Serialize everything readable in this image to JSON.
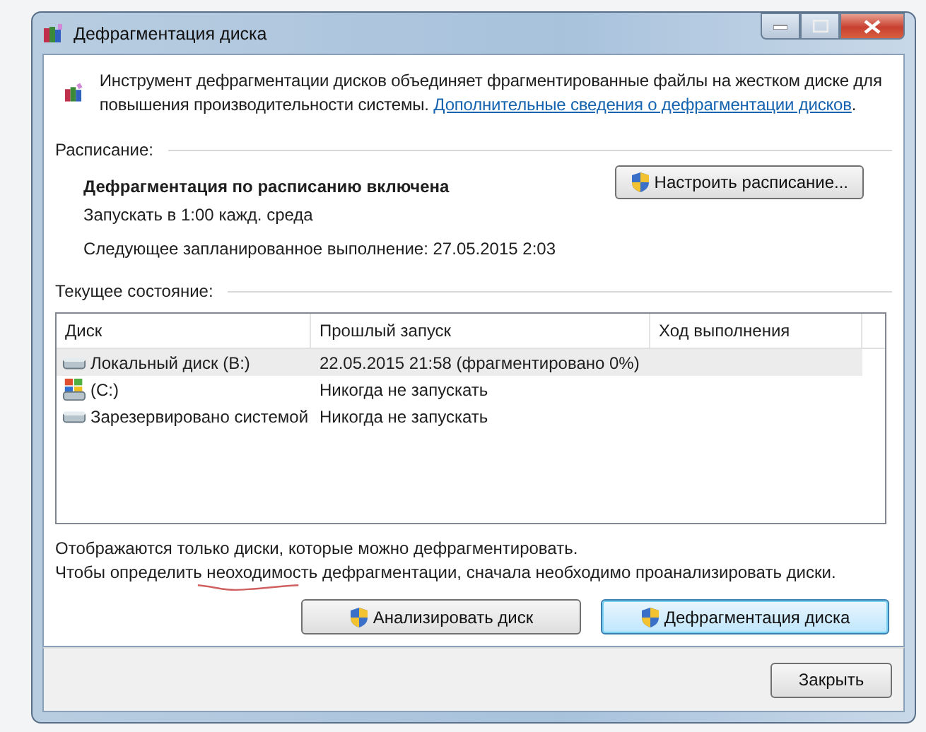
{
  "window": {
    "title": "Дефрагментация диска"
  },
  "intro": {
    "text": "Инструмент дефрагментации дисков объединяет фрагментированные файлы на жестком диске для повышения производительности системы.",
    "link": "Дополнительные сведения о дефрагментации дисков",
    "after_link": "."
  },
  "schedule": {
    "heading": "Расписание:",
    "status": "Дефрагментация по расписанию включена",
    "run": "Запускать в 1:00 кажд. среда",
    "next": "Следующее запланированное выполнение: 27.05.2015 2:03",
    "button": "Настроить расписание..."
  },
  "current": {
    "heading": "Текущее состояние:"
  },
  "table": {
    "columns": [
      "Диск",
      "Прошлый запуск",
      "Ход выполнения"
    ],
    "rows": [
      {
        "kind": "drive",
        "disk": "Локальный диск (B:)",
        "last_run": "22.05.2015 21:58 (фрагментировано 0%)",
        "selected": true
      },
      {
        "kind": "system",
        "disk": "(C:)",
        "last_run": "Никогда не запускать",
        "selected": false
      },
      {
        "kind": "drive",
        "disk": "Зарезервировано системой",
        "last_run": "Никогда не запускать",
        "selected": false
      }
    ]
  },
  "notes": [
    "Отображаются только диски, которые можно дефрагментировать.",
    "Чтобы определить неоходимость  дефрагментации, сначала необходимо проанализировать диски."
  ],
  "buttons": [
    {
      "label": "Анализировать диск",
      "default": false
    },
    {
      "label": "Дефрагментация диска",
      "default": true
    }
  ],
  "footer": {
    "close": "Закрыть"
  }
}
